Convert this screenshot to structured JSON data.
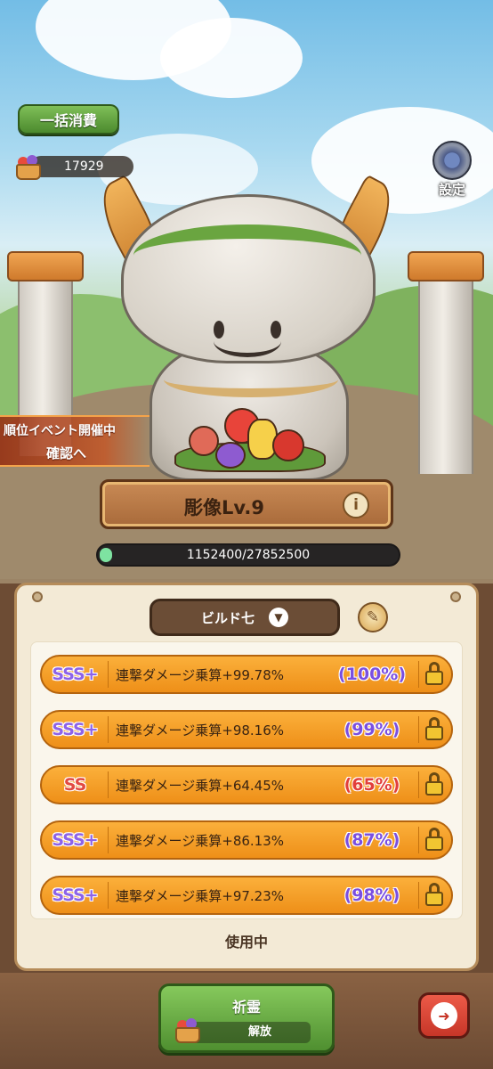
{
  "header": {
    "bulk_consume_label": "一括消費",
    "currency_amount": "17929",
    "currency_icon": "fruit-basket-icon",
    "settings_label": "設定"
  },
  "event": {
    "line1": "順位イベント開催中",
    "line2": "確認へ"
  },
  "statue": {
    "title": "彫像Lv.9",
    "progress_text": "1152400/27852500",
    "progress_fraction": 0.0414
  },
  "build": {
    "tab_label": "ビルド七",
    "rows": [
      {
        "grade": "SSS+",
        "stat": "連撃ダメージ乗算+99.78%",
        "percent": "(100%)"
      },
      {
        "grade": "SSS+",
        "stat": "連撃ダメージ乗算+98.16%",
        "percent": "(99%)"
      },
      {
        "grade": "SS",
        "stat": "連撃ダメージ乗算+64.45%",
        "percent": "(65%)"
      },
      {
        "grade": "SSS+",
        "stat": "連撃ダメージ乗算+86.13%",
        "percent": "(87%)"
      },
      {
        "grade": "SSS+",
        "stat": "連撃ダメージ乗算+97.23%",
        "percent": "(98%)"
      }
    ],
    "status": "使用中"
  },
  "bottom": {
    "prayer_label": "祈霊",
    "release_label": "解放"
  },
  "colors": {
    "sss_grade": "#8d63e8",
    "ss_grade": "#e24a42",
    "row_orange": "#f5a12a",
    "green_button": "#5fa33a",
    "exit_red": "#d84232"
  }
}
